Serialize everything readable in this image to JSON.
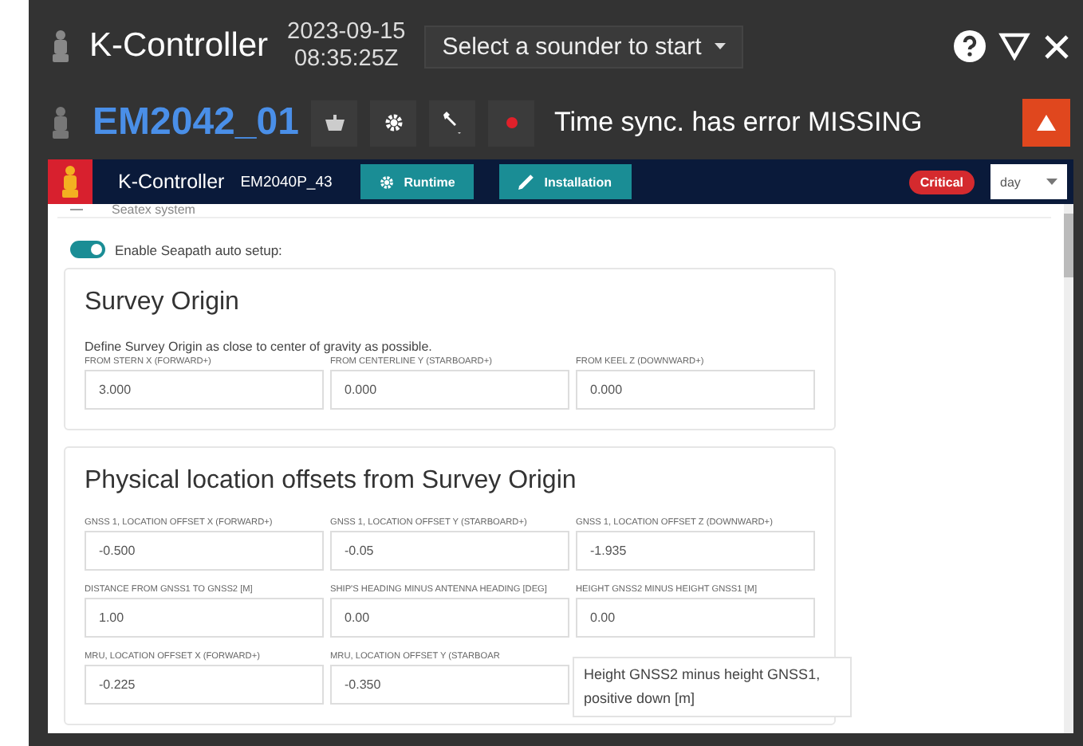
{
  "app_bar": {
    "title": "K-Controller",
    "date": "2023-09-15",
    "time": "08:35:25Z",
    "sounder_select": "Select a sounder to start"
  },
  "sounder_bar": {
    "name": "EM2042_01",
    "status_text": "Time sync. has error MISSING"
  },
  "inner_header": {
    "title": "K-Controller",
    "device": "EM2040P_43",
    "buttons": [
      {
        "label": "Runtime",
        "kind": "gear"
      },
      {
        "label": "Installation",
        "kind": "pencil"
      }
    ],
    "badge": "Critical",
    "theme_select": "day"
  },
  "section": {
    "title": "Seatex system",
    "expanded": true
  },
  "toggle": {
    "label": "Enable Seapath auto setup:",
    "on": true
  },
  "cards": [
    {
      "title": "Survey Origin",
      "description": "Define Survey Origin as close to center of gravity as possible.",
      "fields": [
        {
          "label": "FROM STERN X (FORWARD+)",
          "value": "3.000"
        },
        {
          "label": "FROM CENTERLINE Y (STARBOARD+)",
          "value": "0.000"
        },
        {
          "label": "FROM KEEL Z (DOWNWARD+)",
          "value": "0.000"
        }
      ]
    },
    {
      "title": "Physical location offsets from Survey Origin",
      "fields": [
        {
          "label": "GNSS 1, LOCATION OFFSET X (FORWARD+)",
          "value": "-0.500"
        },
        {
          "label": "GNSS 1, LOCATION OFFSET Y (STARBOARD+)",
          "value": "-0.05"
        },
        {
          "label": "GNSS 1, LOCATION OFFSET Z (DOWNWARD+)",
          "value": "-1.935"
        },
        {
          "label": "DISTANCE FROM GNSS1 TO GNSS2 [M]",
          "value": "1.00"
        },
        {
          "label": "SHIP'S HEADING MINUS ANTENNA HEADING [DEG]",
          "value": "0.00"
        },
        {
          "label": "HEIGHT GNSS2 MINUS HEIGHT GNSS1 [M]",
          "value": "0.00"
        },
        {
          "label": "MRU, LOCATION OFFSET X (FORWARD+)",
          "value": "-0.225"
        },
        {
          "label": "MRU, LOCATION OFFSET Y (STARBOAR",
          "value": "-0.350"
        }
      ]
    }
  ],
  "tooltip": "Height GNSS2 minus height GNSS1, positive down [m]"
}
